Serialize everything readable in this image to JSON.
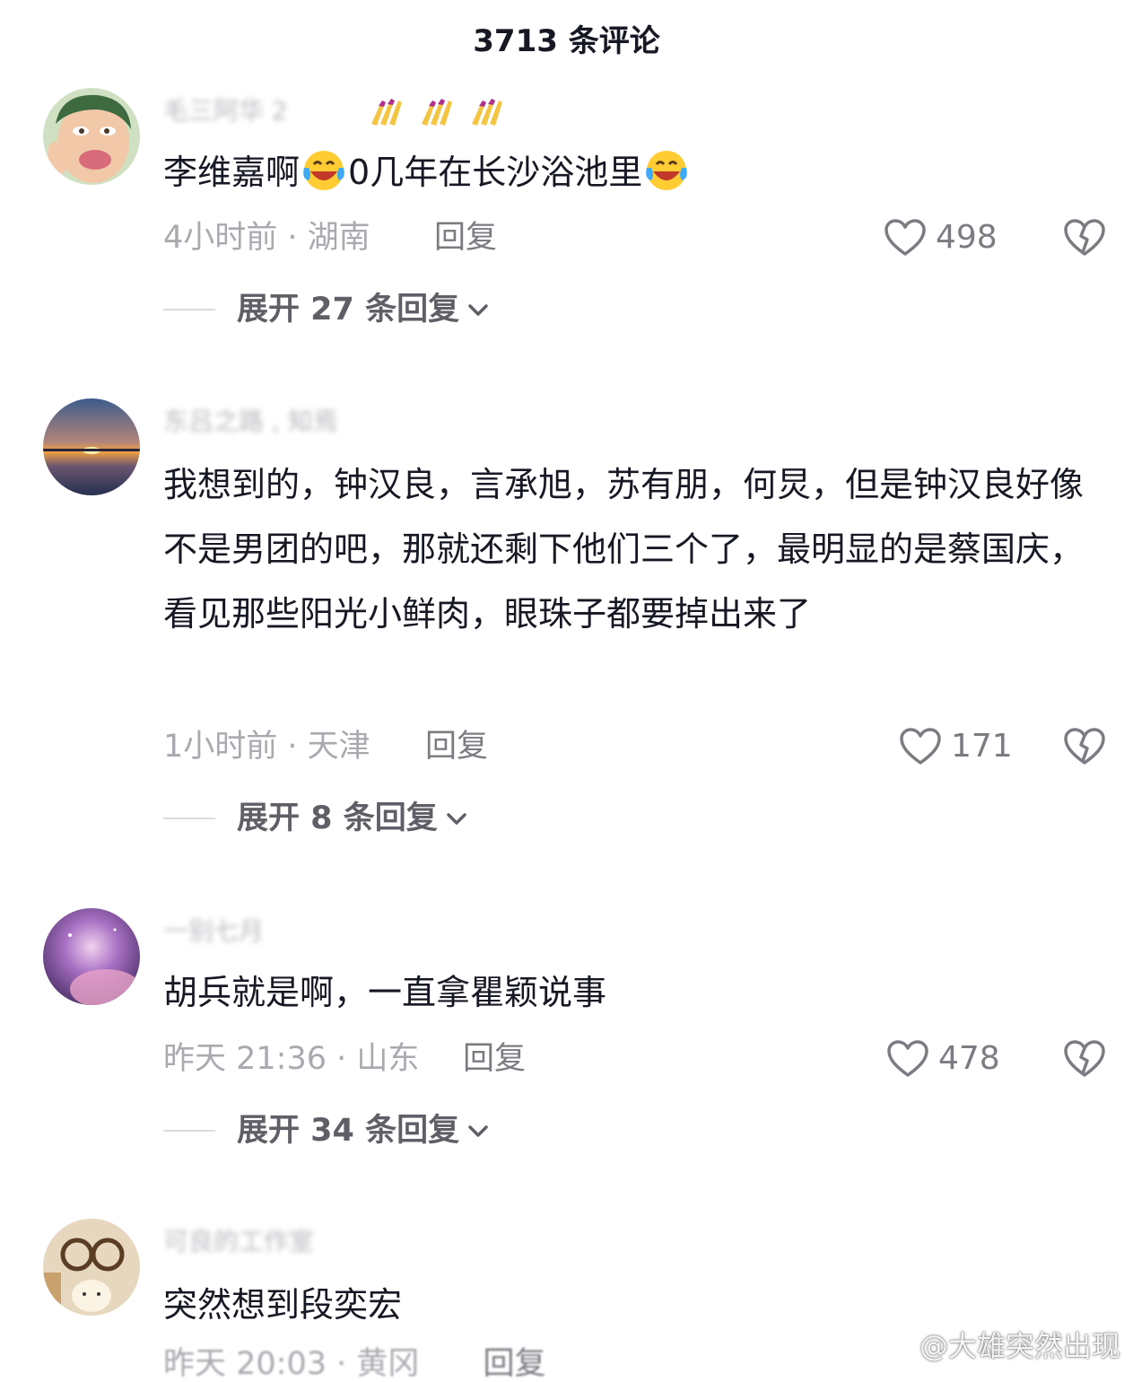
{
  "header": {
    "title": "3713 条评论"
  },
  "comments": [
    {
      "username": "毛三阿华 2",
      "content": [
        "李维嘉啊",
        "0几年在长沙浴池里"
      ],
      "time": "4小时前 · 湖南",
      "reply_label": "回复",
      "likes": "498",
      "expand_label": "展开 27 条回复"
    },
    {
      "username": "东吕之路 , 知焉",
      "content": [
        "我想到的，钟汉良，言承旭，苏有朋，何炅，但是钟汉良好像不是男团的吧，那就还剩下他们三个了，最明显的是蔡国庆，看见那些阳光小鲜肉，眼珠子都要掉出来了"
      ],
      "time": "1小时前 · 天津",
      "reply_label": "回复",
      "likes": "171",
      "expand_label": "展开 8 条回复"
    },
    {
      "username": "一别七月",
      "content": [
        "胡兵就是啊，一直拿瞿颖说事"
      ],
      "time": "昨天 21:36 · 山东",
      "reply_label": "回复",
      "likes": "478",
      "expand_label": "展开 34 条回复"
    },
    {
      "username": "可良的工作室",
      "content": [
        "突然想到段奕宏"
      ],
      "time": "昨天 20:03 · 黄冈",
      "reply_label": "回复"
    }
  ],
  "watermark": {
    "text": "@大雄突然出现"
  },
  "colors": {
    "text": "#161823",
    "meta": "#a9aab0",
    "icon": "#7b7c82"
  },
  "icons": [
    "heart-icon",
    "broken-heart-icon",
    "chevron-down-icon",
    "crying-laugh-emoji",
    "nail-polish-emoji",
    "weibo-icon"
  ]
}
